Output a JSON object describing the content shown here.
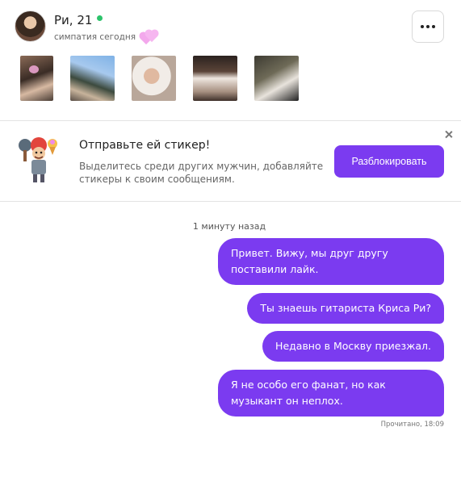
{
  "profile": {
    "name": "Ри, 21",
    "sympathy": "симпатия сегодня",
    "online_color": "#2cc36b",
    "more_icon": "more-horizontal-icon",
    "photos_count": 5
  },
  "promo": {
    "title": "Отправьте ей стикер!",
    "text": "Выделитесь среди других мужчин, добавляйте стикеры к своим сообщениям.",
    "button": "Разблокировать",
    "close_icon": "close-icon",
    "icon": "sticker-character-icon"
  },
  "chat": {
    "time": "1 минуту назад",
    "messages": [
      "Привет. Вижу, мы друг другу поставили лайк.",
      "Ты знаешь гитариста Криса Ри?",
      "Недавно в Москву приезжал.",
      "Я не особо его фанат, но как музыкант он неплох."
    ],
    "read_status": "Прочитано, 18:09"
  },
  "colors": {
    "accent": "#7b3bf0",
    "hearts": "#f08be6"
  }
}
